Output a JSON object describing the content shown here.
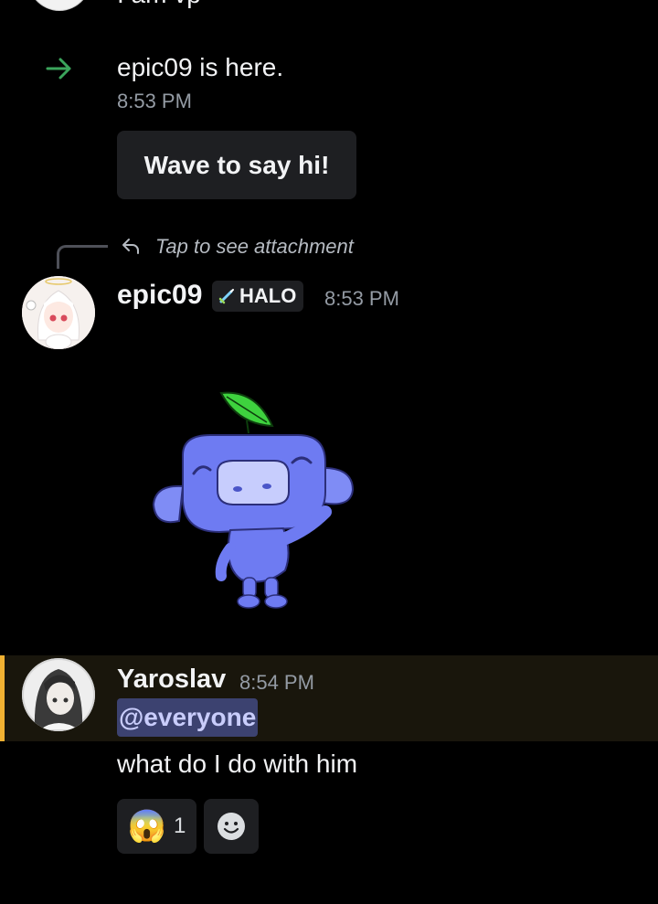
{
  "top_message": {
    "text": "I am vp"
  },
  "join": {
    "username": "epic09",
    "suffix": " is here.",
    "time": "8:53 PM",
    "wave_label": "Wave to say hi!"
  },
  "reply": {
    "text": "Tap to see attachment"
  },
  "message1": {
    "username": "epic09",
    "tag": "HALO",
    "time": "8:53 PM",
    "sticker": "wumpus-wave-sticker"
  },
  "message2": {
    "username": "Yaroslav",
    "time": "8:54 PM",
    "mention": "@everyone",
    "body": "what do I do with him"
  },
  "reactions": [
    {
      "emoji": "😱",
      "count": "1"
    },
    {
      "emoji": "add-reaction-icon"
    }
  ],
  "colors": {
    "background": "#000000",
    "join_arrow": "#3ba55c",
    "mention_bar": "#f0b132",
    "mention_pill_bg": "#3c4270",
    "mention_pill_text": "#c9cdfb",
    "wumpus": "#5865f2"
  }
}
